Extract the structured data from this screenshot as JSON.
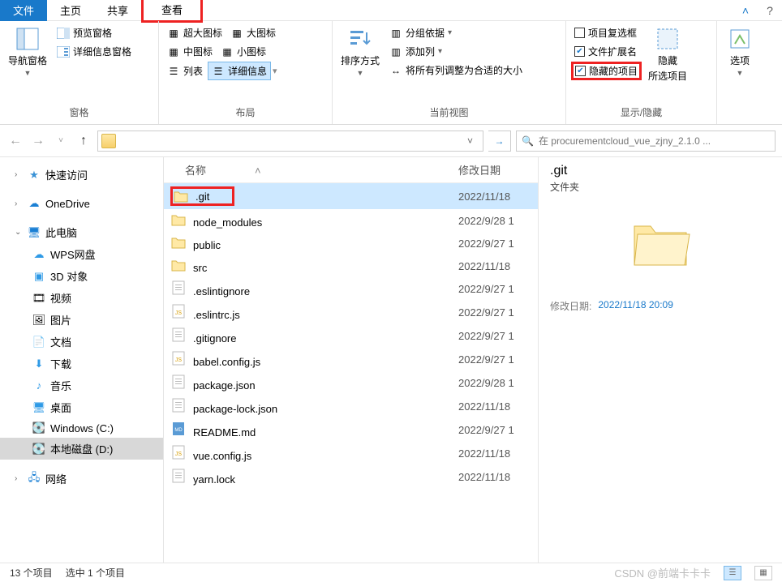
{
  "tabs": {
    "file": "文件",
    "home": "主页",
    "share": "共享",
    "view": "查看"
  },
  "ribbon": {
    "panes": {
      "label": "窗格",
      "nav": "导航窗格",
      "preview": "预览窗格",
      "details": "详细信息窗格"
    },
    "layout": {
      "label": "布局",
      "xlarge": "超大图标",
      "large": "大图标",
      "medium": "中图标",
      "small": "小图标",
      "list": "列表",
      "details": "详细信息"
    },
    "current": {
      "label": "当前视图",
      "sort": "排序方式",
      "group": "分组依据",
      "addcol": "添加列",
      "fit": "将所有列调整为合适的大小"
    },
    "show": {
      "label": "显示/隐藏",
      "chkboxes": "项目复选框",
      "ext": "文件扩展名",
      "hidden": "隐藏的项目",
      "hide": "隐藏",
      "hidesel": "所选项目"
    },
    "options": "选项"
  },
  "search": {
    "placeholder": "在 procurementcloud_vue_zjny_2.1.0 ..."
  },
  "tree": {
    "quick": "快速访问",
    "onedrive": "OneDrive",
    "thispc": "此电脑",
    "wps": "WPS网盘",
    "threed": "3D 对象",
    "videos": "视频",
    "pictures": "图片",
    "docs": "文档",
    "downloads": "下载",
    "music": "音乐",
    "desktop": "桌面",
    "cdrive": "Windows (C:)",
    "ddrive": "本地磁盘 (D:)",
    "network": "网络"
  },
  "columns": {
    "name": "名称",
    "date": "修改日期"
  },
  "files": [
    {
      "name": ".git",
      "date": "2022/11/18",
      "type": "folder",
      "sel": true
    },
    {
      "name": "node_modules",
      "date": "2022/9/28 1",
      "type": "folder"
    },
    {
      "name": "public",
      "date": "2022/9/27 1",
      "type": "folder"
    },
    {
      "name": "src",
      "date": "2022/11/18",
      "type": "folder"
    },
    {
      "name": ".eslintignore",
      "date": "2022/9/27 1",
      "type": "file"
    },
    {
      "name": ".eslintrc.js",
      "date": "2022/9/27 1",
      "type": "js"
    },
    {
      "name": ".gitignore",
      "date": "2022/9/27 1",
      "type": "file"
    },
    {
      "name": "babel.config.js",
      "date": "2022/9/27 1",
      "type": "js"
    },
    {
      "name": "package.json",
      "date": "2022/9/28 1",
      "type": "file"
    },
    {
      "name": "package-lock.json",
      "date": "2022/11/18",
      "type": "file"
    },
    {
      "name": "README.md",
      "date": "2022/9/27 1",
      "type": "md"
    },
    {
      "name": "vue.config.js",
      "date": "2022/11/18",
      "type": "js"
    },
    {
      "name": "yarn.lock",
      "date": "2022/11/18",
      "type": "file"
    }
  ],
  "details": {
    "title": ".git",
    "type": "文件夹",
    "mlabel": "修改日期:",
    "mval": "2022/11/18 20:09"
  },
  "status": {
    "count": "13 个项目",
    "sel": "选中 1 个项目"
  },
  "watermark": "CSDN @前端卡卡卡"
}
